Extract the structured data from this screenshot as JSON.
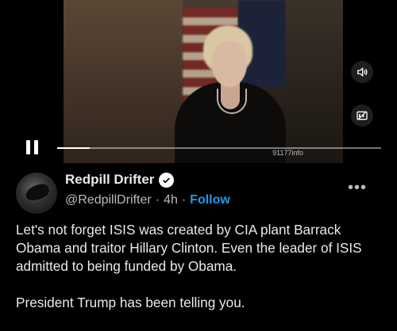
{
  "video": {
    "watermark": "91177info",
    "progress_fraction": 0.1,
    "controls": {
      "pause_icon": "pause-icon",
      "volume_icon": "volume-icon",
      "captions_icon": "captions-off-icon"
    }
  },
  "tweet": {
    "author_name": "Redpill Drifter",
    "handle": "@RedpillDrifter",
    "separator": "·",
    "time": "4h",
    "separator2": "·",
    "follow_label": "Follow",
    "more_label": "•••",
    "paragraphs": [
      "Let's not forget ISIS was created by CIA plant Barrack Obama and traitor Hillary Clinton. Even the leader of ISIS admitted to being funded by Obama.",
      "President Trump has been telling you."
    ]
  },
  "colors": {
    "background": "#000000",
    "text": "#e7e9ea",
    "muted": "#b9bcc0",
    "link": "#1d9bf0"
  }
}
